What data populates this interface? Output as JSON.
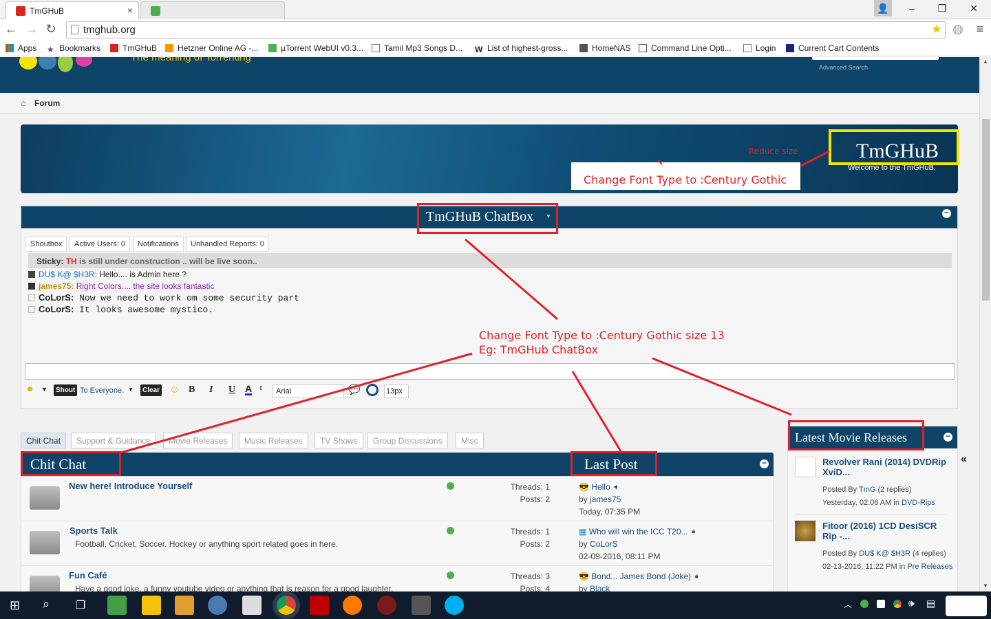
{
  "browser": {
    "tab_title": "TmGHuB",
    "url": "tmghub.org",
    "bookmarks": [
      "Apps",
      "Bookmarks",
      "TmGHuB",
      "Hetzner Online AG -...",
      "µTorrent WebUI v0.3...",
      "Tamil Mp3 Songs D...",
      "List of highest-gross...",
      "HomeNAS",
      "Command Line Opti...",
      "Login",
      "Current Cart Contents"
    ]
  },
  "header": {
    "tagline": "The meaning of Torrenting",
    "advanced_search": "Advanced Search"
  },
  "breadcrumb": {
    "label": "Forum"
  },
  "banner": {
    "title": "TmGHuB",
    "subtitle": "Welcome to the TmGHuB."
  },
  "chatbox": {
    "title": "TmGHuB ChatBox",
    "tabs": [
      "Shoutbox",
      "Active Users: 0",
      "Notifications",
      "Unhandled Reports: 0"
    ],
    "sticky_label": "Sticky:",
    "sticky_user": "TH",
    "sticky_text": "is still under construction .. will be live soon..",
    "messages": [
      {
        "user": "DU$ K@ $H3R:",
        "text": "Hello.... is Admin here ?"
      },
      {
        "user": "james75:",
        "text": "Right Colors.... the site looks fantastic"
      },
      {
        "user": "CoLorS:",
        "text": "Now we need to work om some security part"
      },
      {
        "user": "CoLorS:",
        "text": "It looks awesome mystico."
      }
    ],
    "toolbar": {
      "shout": "Shout",
      "to": "To Everyone.",
      "clear": "Clear",
      "bold": "B",
      "italic": "I",
      "underline": "U",
      "color": "A",
      "font": "Arial",
      "size": "13px"
    }
  },
  "forum_tabs": [
    "Chit Chat",
    "Support & Guidance",
    "Movie Releases",
    "Music Releases",
    "TV Shows",
    "Group Discussions",
    "Misc"
  ],
  "forum": {
    "section_title": "Chit Chat",
    "last_post_header": "Last Post",
    "rows": [
      {
        "title": "New here! Introduce Yourself",
        "desc": "",
        "threads": "Threads: 1",
        "posts": "Posts: 2",
        "lp_title": "Hello",
        "lp_by": "by",
        "lp_user": "james75",
        "lp_date": "Today,",
        "lp_time": "07:35 PM"
      },
      {
        "title": "Sports Talk",
        "desc": "Football, Cricket, Soccer, Hockey or anything sport related goes in here.",
        "threads": "Threads: 1",
        "posts": "Posts: 2",
        "lp_title": "Who will win the ICC T20...",
        "lp_by": "by",
        "lp_user": "CoLorS",
        "lp_date": "02-09-2016,",
        "lp_time": "08:11 PM"
      },
      {
        "title": "Fun Café",
        "desc": "Have a good joke, a funny youtube video or anything that is reason for a good laughter.",
        "threads": "Threads: 3",
        "posts": "Posts: 4",
        "lp_title": "Bond... James Bond (Joke)",
        "lp_by": "by",
        "lp_user": "Black",
        "lp_date": "",
        "lp_time": ""
      }
    ]
  },
  "sidebar": {
    "title": "Latest Movie Releases",
    "items": [
      {
        "title": "Revolver Rani (2014) DVDRip XviD...",
        "posted_by": "Posted By",
        "user": "TmG",
        "replies": "(2 replies)",
        "date": "Yesterday,",
        "time": "02:06 AM",
        "in": "in",
        "category": "DVD-Rips"
      },
      {
        "title": "Fitoor (2016) 1CD DesiSCR Rip -...",
        "posted_by": "Posted By",
        "user": "DU$ K@ $H3R",
        "replies": "(4 replies)",
        "date": "02-13-2016,",
        "time": "11:22 PM",
        "in": "in",
        "category": "Pre Releases"
      }
    ]
  },
  "annotations": {
    "reduce_size": "Reduce size",
    "change_font_banner": "Change Font Type to :Century Gothic",
    "change_font_line1": "Change Font Type to :Century Gothic size 13",
    "change_font_line2": "Eg: TmGHub ChatBox"
  },
  "colors": {
    "header_blue": "#0d4467",
    "annotation_red": "#e0202a",
    "highlight_yellow": "#f2e600"
  }
}
